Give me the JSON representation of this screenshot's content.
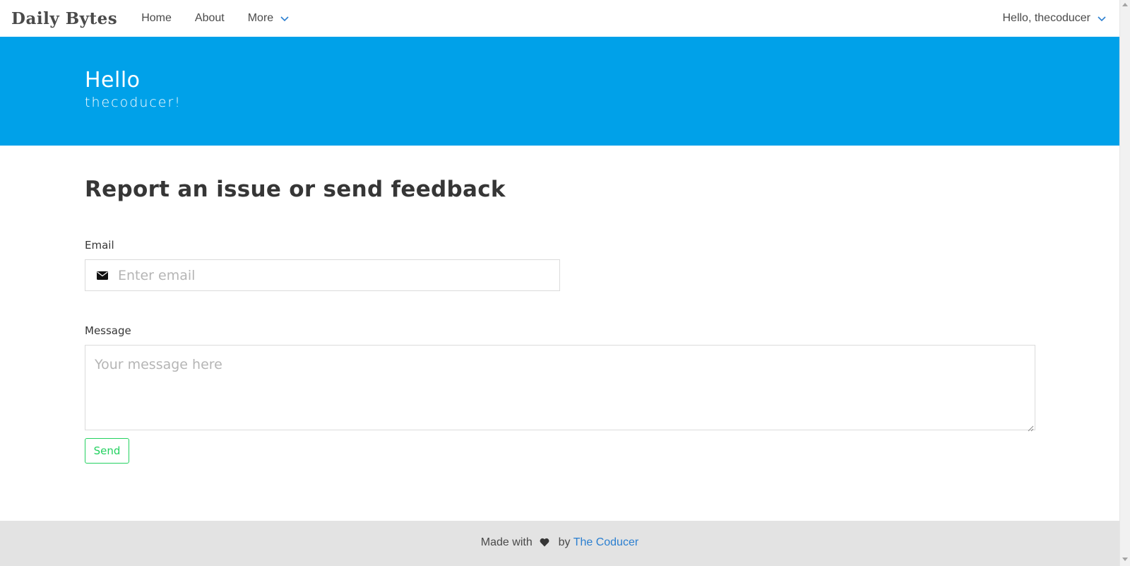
{
  "navbar": {
    "brand": "Daily Bytes",
    "items": [
      {
        "label": "Home"
      },
      {
        "label": "About"
      },
      {
        "label": "More"
      }
    ],
    "user_menu": "Hello, thecoducer"
  },
  "hero": {
    "title": "Hello",
    "subtitle": "thecoducer!"
  },
  "form": {
    "title": "Report an issue or send feedback",
    "email_label": "Email",
    "email_placeholder": "Enter email",
    "email_value": "",
    "message_label": "Message",
    "message_placeholder": "Your message here",
    "message_value": "",
    "send_label": "Send"
  },
  "footer": {
    "made_with": "Made with",
    "by": "by",
    "author_link": "The Coducer"
  },
  "colors": {
    "hero_bg": "#00a1e9",
    "send_accent": "#23d160",
    "link": "#2b7fd0",
    "footer_bg": "#e3e3e3",
    "chevron": "#2b7fd0"
  },
  "icons": {
    "more_dropdown": "chevron-down-icon",
    "user_dropdown": "chevron-down-icon",
    "email": "envelope-icon",
    "footer": "heart-icon"
  }
}
